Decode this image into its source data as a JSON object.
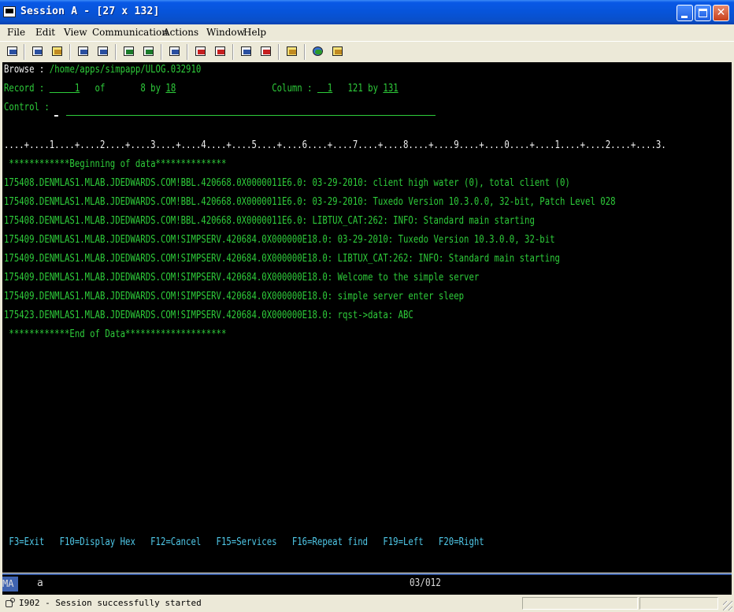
{
  "window": {
    "title": "Session A - [27 x 132]"
  },
  "menubar": {
    "items": [
      "File",
      "Edit",
      "View",
      "Communication",
      "Actions",
      "Window",
      "Help"
    ]
  },
  "toolbar": {
    "icons": [
      "print-screen-icon",
      "copy-icon",
      "paste-icon",
      "send-icon",
      "receive-icon",
      "display-icon",
      "color-map-icon",
      "keyboard-map-icon",
      "record-macro-icon",
      "play-macro-icon",
      "stop-macro-icon",
      "macro-icon",
      "clipboard-icon",
      "globe-icon",
      "help-icon"
    ]
  },
  "terminal": {
    "browse_label": "Browse :",
    "browse_path": "/home/apps/simpapp/ULOG.032910",
    "record_label": "Record :",
    "record_value": "     1",
    "record_of": "of",
    "record_total": "8 by",
    "record_width": "18",
    "column_label": "Column :",
    "column_value": "  1",
    "column_total": "121 by",
    "column_width": "131",
    "control_label": "Control :",
    "ruler": "....+....1....+....2....+....3....+....4....+....5....+....6....+....7....+....8....+....9....+....0....+....1....+....2....+....3.",
    "begin_marker": " ************Beginning of data**************",
    "data_lines": [
      "175408.DENMLAS1.MLAB.JDEDWARDS.COM!BBL.420668.0X0000011E6.0: 03-29-2010: client high water (0), total client (0)",
      "175408.DENMLAS1.MLAB.JDEDWARDS.COM!BBL.420668.0X0000011E6.0: 03-29-2010: Tuxedo Version 10.3.0.0, 32-bit, Patch Level 028",
      "175408.DENMLAS1.MLAB.JDEDWARDS.COM!BBL.420668.0X0000011E6.0: LIBTUX_CAT:262: INFO: Standard main starting",
      "175409.DENMLAS1.MLAB.JDEDWARDS.COM!SIMPSERV.420684.0X000000E18.0: 03-29-2010: Tuxedo Version 10.3.0.0, 32-bit",
      "175409.DENMLAS1.MLAB.JDEDWARDS.COM!SIMPSERV.420684.0X000000E18.0: LIBTUX_CAT:262: INFO: Standard main starting",
      "175409.DENMLAS1.MLAB.JDEDWARDS.COM!SIMPSERV.420684.0X000000E18.0: Welcome to the simple server",
      "175409.DENMLAS1.MLAB.JDEDWARDS.COM!SIMPSERV.420684.0X000000E18.0: simple server enter sleep",
      "175423.DENMLAS1.MLAB.JDEDWARDS.COM!SIMPSERV.420684.0X000000E18.0: rqst->data: ABC"
    ],
    "end_marker": " ************End of Data********************",
    "function_keys": " F3=Exit   F10=Display Hex   F12=Cancel   F15=Services   F16=Repeat find   F19=Left   F20=Right"
  },
  "oia": {
    "session_indicator": "MA",
    "session_letter": "a",
    "cursor_position": "03/012"
  },
  "statusbar": {
    "message": "I902 - Session successfully started"
  }
}
